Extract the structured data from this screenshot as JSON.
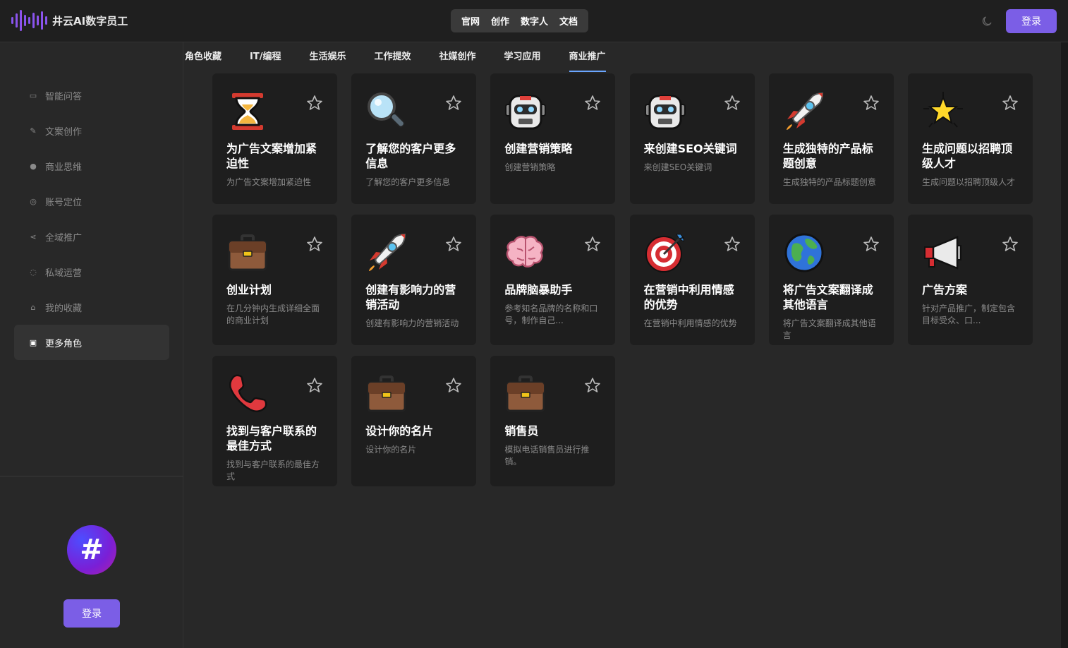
{
  "header": {
    "app_name": "井云AI数字员工",
    "nav": [
      "官网",
      "创作",
      "数字人",
      "文档"
    ],
    "login_label": "登录"
  },
  "sidebar": {
    "items": [
      {
        "label": "智能问答",
        "icon": "chat-icon"
      },
      {
        "label": "文案创作",
        "icon": "pen-icon"
      },
      {
        "label": "商业思维",
        "icon": "bulb-icon"
      },
      {
        "label": "账号定位",
        "icon": "target-icon"
      },
      {
        "label": "全域推广",
        "icon": "share-icon"
      },
      {
        "label": "私域运营",
        "icon": "message-icon"
      },
      {
        "label": "我的收藏",
        "icon": "collection-icon"
      },
      {
        "label": "更多角色",
        "icon": "grid-icon",
        "active": true
      }
    ],
    "avatar_glyph": "#",
    "login_label": "登录"
  },
  "tabs": {
    "items": [
      "角色收藏",
      "IT/编程",
      "生活娱乐",
      "工作提效",
      "社媒创作",
      "学习应用",
      "商业推广"
    ],
    "active": "商业推广"
  },
  "cards": [
    {
      "emoji": "hourglass",
      "title": "为广告文案增加紧迫性",
      "desc": "为广告文案增加紧迫性"
    },
    {
      "emoji": "magnifier",
      "title": "了解您的客户更多信息",
      "desc": "了解您的客户更多信息"
    },
    {
      "emoji": "robot",
      "title": "创建营销策略",
      "desc": "创建营销策略"
    },
    {
      "emoji": "robot",
      "title": "来创建SEO关键词",
      "desc": "来创建SEO关键词"
    },
    {
      "emoji": "rocket",
      "title": "生成独特的产品标题创意",
      "desc": "生成独特的产品标题创意"
    },
    {
      "emoji": "star-glow",
      "title": "生成问题以招聘顶级人才",
      "desc": "生成问题以招聘顶级人才"
    },
    {
      "emoji": "briefcase",
      "title": "创业计划",
      "desc": "在几分钟内生成详细全面的商业计划"
    },
    {
      "emoji": "rocket",
      "title": "创建有影响力的营销活动",
      "desc": "创建有影响力的营销活动"
    },
    {
      "emoji": "brain",
      "title": "品牌脑暴助手",
      "desc": "参考知名品牌的名称和口号，制作自己..."
    },
    {
      "emoji": "dart",
      "title": "在营销中利用情感的优势",
      "desc": "在营销中利用情感的优势"
    },
    {
      "emoji": "globe",
      "title": "将广告文案翻译成其他语言",
      "desc": "将广告文案翻译成其他语言"
    },
    {
      "emoji": "megaphone",
      "title": "广告方案",
      "desc": "针对产品推广，制定包含目标受众、口..."
    },
    {
      "emoji": "phone",
      "title": "找到与客户联系的最佳方式",
      "desc": "找到与客户联系的最佳方式"
    },
    {
      "emoji": "briefcase",
      "title": "设计你的名片",
      "desc": "设计你的名片"
    },
    {
      "emoji": "briefcase",
      "title": "销售员",
      "desc": "模拟电话销售员进行推销。"
    }
  ]
}
